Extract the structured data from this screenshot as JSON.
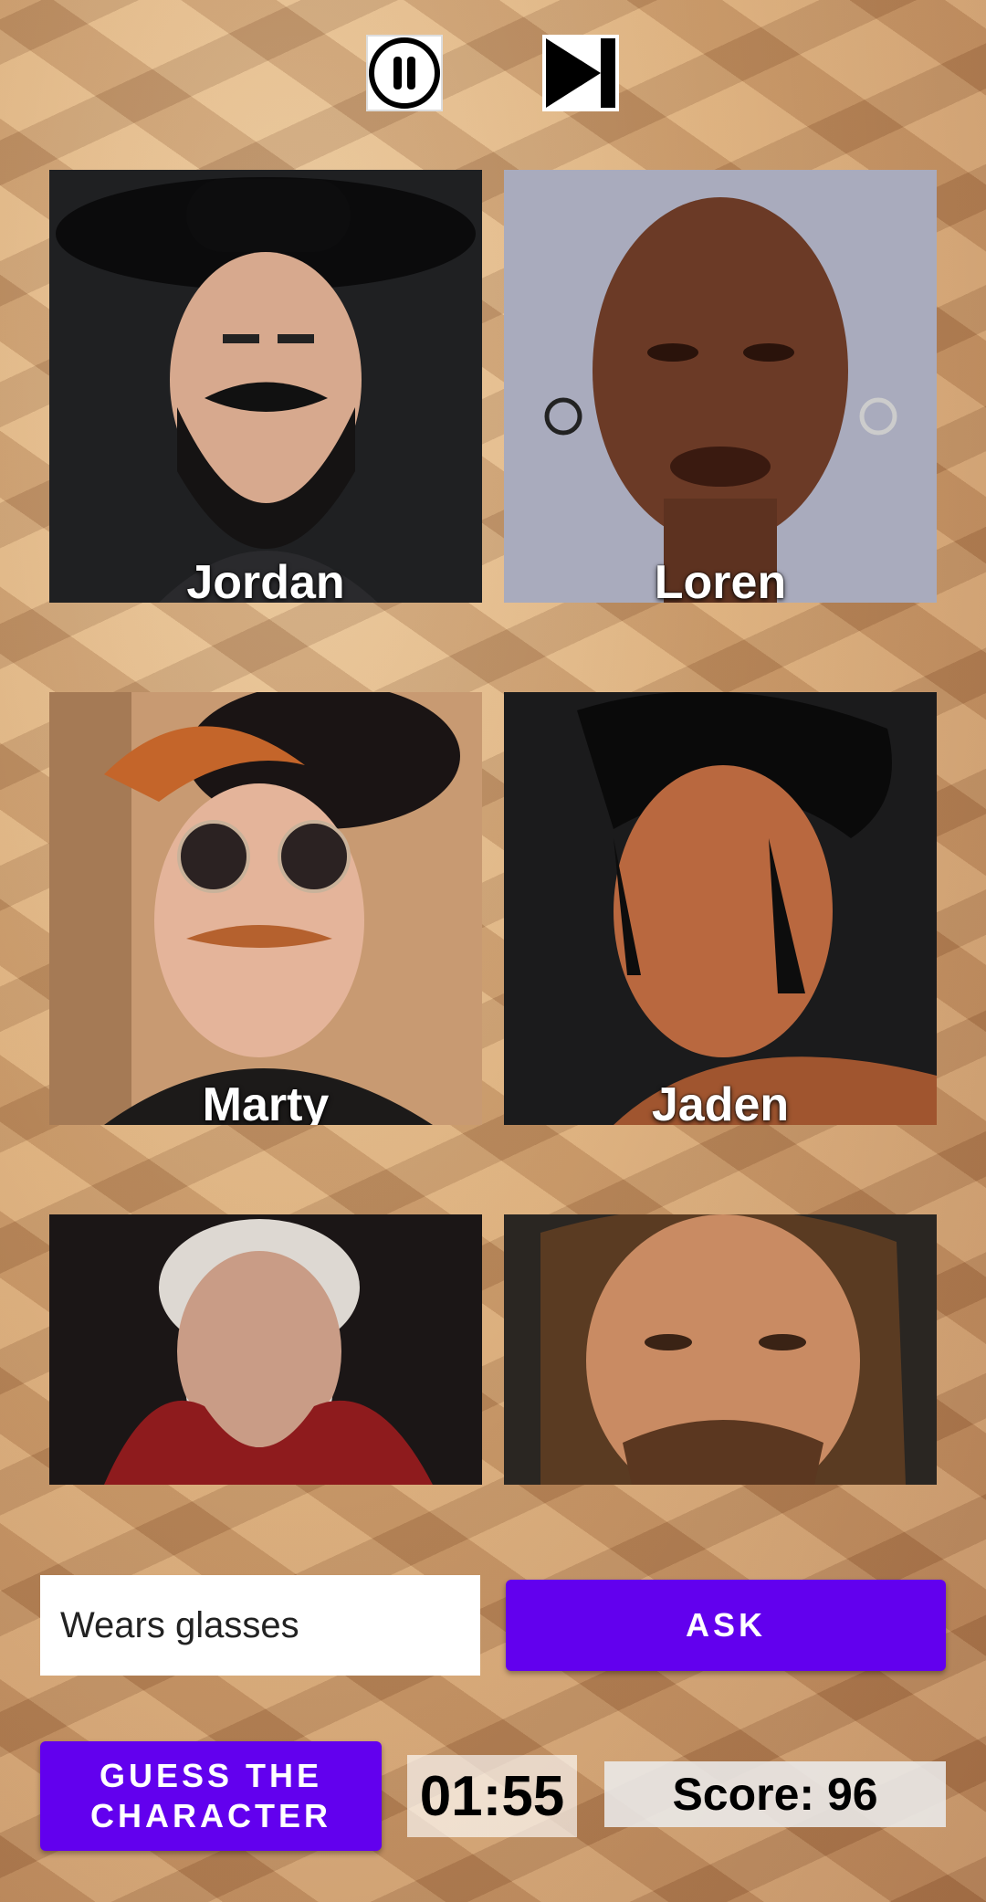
{
  "controls": {
    "pause_icon": "pause-icon",
    "next_icon": "skip-next-icon"
  },
  "characters": [
    {
      "name": "Jordan"
    },
    {
      "name": "Loren"
    },
    {
      "name": "Marty"
    },
    {
      "name": "Jaden"
    },
    {
      "name": ""
    },
    {
      "name": ""
    }
  ],
  "question": {
    "value": "Wears glasses",
    "ask_label": "ASK"
  },
  "footer": {
    "guess_label": "GUESS THE\nCHARACTER",
    "timer": "01:55",
    "score": "Score: 96"
  },
  "colors": {
    "accent": "#6200ee"
  }
}
